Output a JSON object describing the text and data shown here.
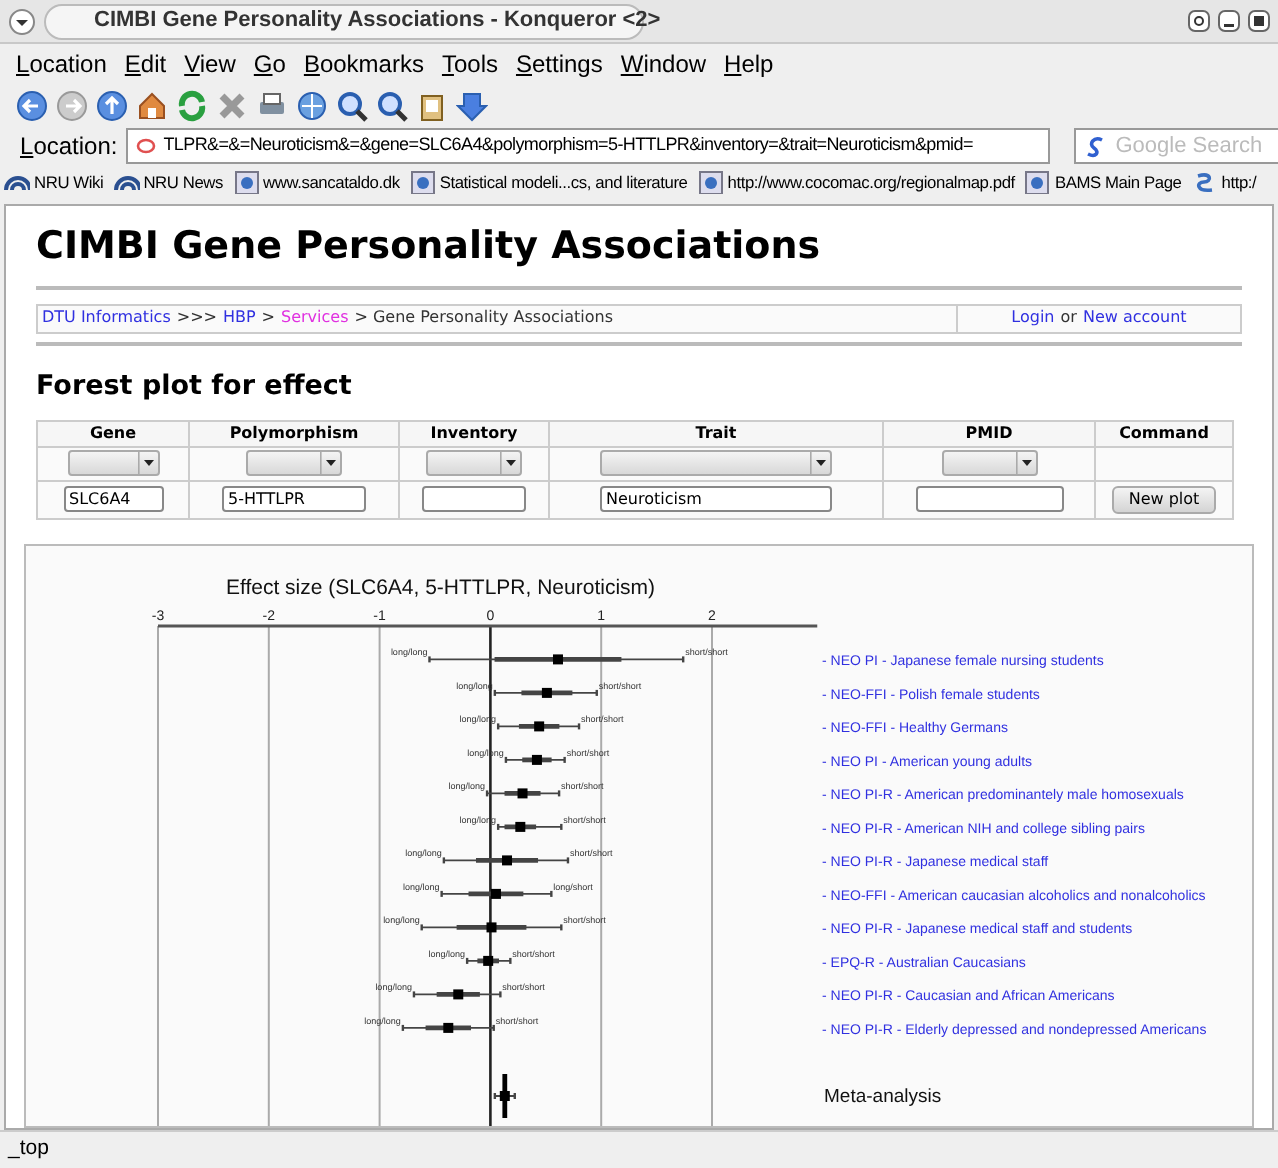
{
  "window": {
    "title": "CIMBI Gene Personality Associations - Konqueror <2>"
  },
  "menu": [
    "Location",
    "Edit",
    "View",
    "Go",
    "Bookmarks",
    "Tools",
    "Settings",
    "Window",
    "Help"
  ],
  "location_bar": {
    "label": "Location:",
    "url": "TLPR&=&=Neuroticism&=&gene=SLC6A4&polymorphism=5-HTTLPR&inventory=&trait=Neuroticism&pmid=",
    "search_placeholder": "Google Search"
  },
  "bookmarks": [
    {
      "label": "NRU Wiki",
      "kind": "wiki"
    },
    {
      "label": "NRU News",
      "kind": "wiki"
    },
    {
      "label": "www.sancataldo.dk",
      "kind": "page"
    },
    {
      "label": "Statistical modeli...cs, and literature",
      "kind": "page"
    },
    {
      "label": "http://www.cocomac.org/regionalmap.pdf",
      "kind": "page"
    },
    {
      "label": "BAMS Main Page",
      "kind": "page"
    },
    {
      "label": "http:/",
      "kind": "link"
    }
  ],
  "page": {
    "title": "CIMBI Gene Personality Associations",
    "breadcrumb": [
      {
        "text": "DTU Informatics",
        "kind": "link"
      },
      {
        "text": ">>>",
        "kind": "text"
      },
      {
        "text": "HBP",
        "kind": "link"
      },
      {
        "text": ">",
        "kind": "text"
      },
      {
        "text": "Services",
        "kind": "visited"
      },
      {
        "text": "> Gene Personality Associations",
        "kind": "text"
      }
    ],
    "account": [
      {
        "text": "Login",
        "kind": "link"
      },
      {
        "text": "or",
        "kind": "text"
      },
      {
        "text": "New account",
        "kind": "link"
      }
    ],
    "section_title": "Forest plot for effect",
    "form": {
      "columns": [
        "Gene",
        "Polymorphism",
        "Inventory",
        "Trait",
        "PMID",
        "Command"
      ],
      "fields": [
        {
          "kind": "text",
          "value": "SLC6A4"
        },
        {
          "kind": "text",
          "value": "5-HTTLPR"
        },
        {
          "kind": "text"
        },
        {
          "kind": "text",
          "value": "Neuroticism"
        },
        {
          "kind": "text"
        }
      ],
      "button": "New plot"
    },
    "forest_plot": {
      "chart_data": {
        "type": "scatter",
        "orientation": "horizontal",
        "grid": true,
        "title": "Effect size (SLC6A4, 5-HTTLPR, Neuroticism)",
        "xticks": [
          -3,
          -2,
          -1,
          0,
          1,
          2
        ],
        "xlim": [
          -3,
          2.95
        ],
        "categories": [
          "- NEO PI - Japanese female nursing students",
          "- NEO-FFI - Polish female students",
          "- NEO-FFI - Healthy Germans",
          "- NEO PI - American young adults",
          "- NEO PI-R - American predominantely male homosexuals",
          "- NEO PI-R - American NIH and college sibling pairs",
          "- NEO PI-R - Japanese medical staff",
          "- NEO-FFI - American caucasian alcoholics and nonalcoholics",
          "- NEO PI-R - Japanese medical staff and students",
          "- EPQ-R - Australian Caucasians",
          "- NEO PI-R - Caucasian and African Americans",
          "- NEO PI-R - Elderly depressed and nondepressed Americans",
          "Meta-analysis"
        ],
        "series": [
          {
            "color": "#000000",
            "values": [
              0.61,
              0.51,
              0.44,
              0.42,
              0.29,
              0.27,
              0.15,
              0.05,
              0.01,
              -0.02,
              -0.29,
              -0.38,
              0.13
            ]
          },
          {
            "color": "#444444",
            "values": [
              -0.55,
              0.04,
              0.07,
              0.14,
              -0.03,
              0.07,
              -0.42,
              -0.44,
              -0.62,
              -0.21,
              -0.69,
              -0.79,
              0.04
            ]
          },
          {
            "color": "#444444",
            "values": [
              1.74,
              0.96,
              0.8,
              0.67,
              0.62,
              0.64,
              0.7,
              0.55,
              0.64,
              0.18,
              0.09,
              0.03,
              0.22
            ]
          }
        ]
      },
      "rows": [
        {
          "kind": "study",
          "low_label": "long/long",
          "high_label": "short/short"
        },
        {
          "kind": "study",
          "low_label": "long/long",
          "high_label": "short/short"
        },
        {
          "kind": "study",
          "low_label": "long/long",
          "high_label": "short/short"
        },
        {
          "kind": "study",
          "low_label": "long/long",
          "high_label": "short/short"
        },
        {
          "kind": "study",
          "low_label": "long/long",
          "high_label": "short/short"
        },
        {
          "kind": "study",
          "low_label": "long/long",
          "high_label": "short/short"
        },
        {
          "kind": "study",
          "low_label": "long/long",
          "high_label": "short/short"
        },
        {
          "kind": "study",
          "low_label": "long/long",
          "high_label": "long/short"
        },
        {
          "kind": "study",
          "low_label": "long/long",
          "high_label": "short/short"
        },
        {
          "kind": "study",
          "low_label": "long/long",
          "high_label": "short/short"
        },
        {
          "kind": "study",
          "low_label": "long/long",
          "high_label": "short/short"
        },
        {
          "kind": "study",
          "low_label": "long/long",
          "high_label": "short/short"
        },
        {
          "kind": "meta"
        }
      ]
    }
  },
  "status_bar": "_top"
}
